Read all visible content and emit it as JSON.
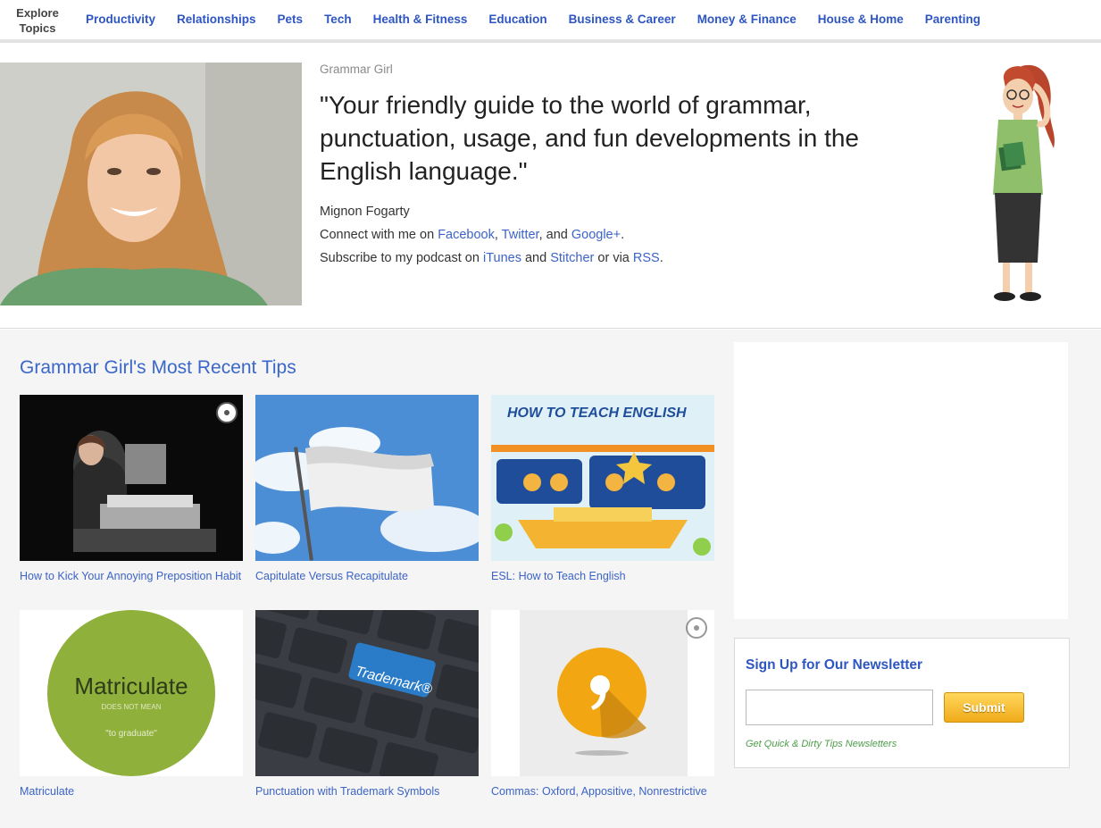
{
  "nav": {
    "explore_line1": "Explore",
    "explore_line2": "Topics",
    "items": [
      {
        "label": "Productivity"
      },
      {
        "label": "Relationships"
      },
      {
        "label": "Pets"
      },
      {
        "label": "Tech"
      },
      {
        "label": "Health & Fitness"
      },
      {
        "label": "Education"
      },
      {
        "label": "Business & Career"
      },
      {
        "label": "Money & Finance"
      },
      {
        "label": "House & Home"
      },
      {
        "label": "Parenting"
      }
    ]
  },
  "hero": {
    "site_name": "Grammar Girl",
    "tagline": "\"Your friendly guide to the world of grammar, punctuation, usage, and fun developments in the English language.\"",
    "author": "Mignon Fogarty",
    "connect_prefix": "Connect with me on ",
    "connect_facebook": "Facebook",
    "connect_sep1": ", ",
    "connect_twitter": "Twitter",
    "connect_sep2": ", and ",
    "connect_google": "Google+",
    "connect_suffix": ".",
    "subscribe_prefix": "Subscribe to my podcast on ",
    "subscribe_itunes": "iTunes",
    "subscribe_and": " and ",
    "subscribe_stitcher": "Stitcher",
    "subscribe_via": " or via ",
    "subscribe_rss": "RSS",
    "subscribe_suffix": "."
  },
  "tips": {
    "title": "Grammar Girl's Most Recent Tips",
    "items": [
      {
        "caption": "How to Kick Your Annoying Preposition Habit"
      },
      {
        "caption": "Capitulate Versus Recapitulate"
      },
      {
        "caption": "ESL: How to Teach English",
        "image_title": "HOW TO TEACH ENGLISH"
      },
      {
        "caption": "Matriculate",
        "image_word": "Matriculate",
        "image_sub1": "DOES NOT MEAN",
        "image_sub2": "\"to graduate\""
      },
      {
        "caption": "Punctuation with Trademark Symbols",
        "image_key": "Trademark®"
      },
      {
        "caption": "Commas: Oxford, Appositive, Nonrestrictive"
      }
    ]
  },
  "newsletter": {
    "title": "Sign Up for Our Newsletter",
    "input_value": "",
    "submit_label": "Submit",
    "note": "Get Quick & Dirty Tips Newsletters"
  },
  "colors": {
    "link_blue": "#2e56c2",
    "accent_gold": "#f0ab1a",
    "note_green": "#4d9e4a"
  }
}
